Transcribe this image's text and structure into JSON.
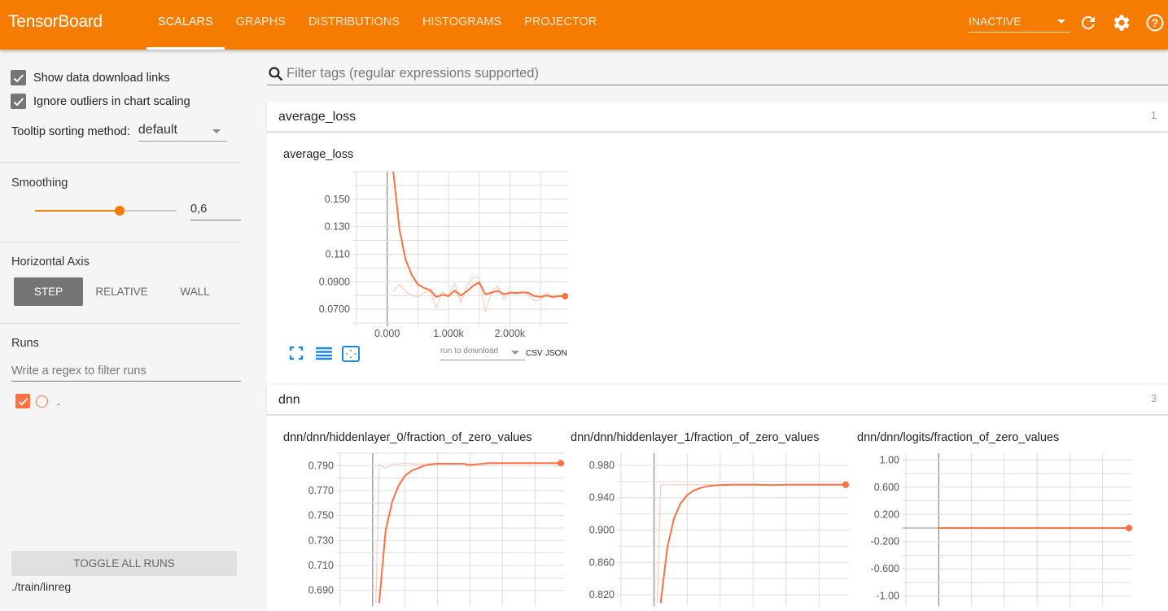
{
  "header": {
    "brand": "TensorBoard",
    "tabs": [
      {
        "label": "SCALARS",
        "active": true
      },
      {
        "label": "GRAPHS",
        "active": false
      },
      {
        "label": "DISTRIBUTIONS",
        "active": false
      },
      {
        "label": "HISTOGRAMS",
        "active": false
      },
      {
        "label": "PROJECTOR",
        "active": false
      }
    ],
    "status_select": "INACTIVE",
    "icons": [
      "refresh-icon",
      "settings-icon",
      "help-icon"
    ],
    "accent_color": "#f57c00"
  },
  "sidebar": {
    "show_download_links": {
      "label": "Show data download links",
      "checked": true
    },
    "ignore_outliers": {
      "label": "Ignore outliers in chart scaling",
      "checked": true
    },
    "tooltip_sorting": {
      "label": "Tooltip sorting method:",
      "value": "default"
    },
    "smoothing": {
      "label": "Smoothing",
      "value": "0,6",
      "fraction": 0.6
    },
    "horizontal_axis": {
      "label": "Horizontal Axis",
      "options": [
        "STEP",
        "RELATIVE",
        "WALL"
      ],
      "selected": "STEP"
    },
    "runs": {
      "label": "Runs",
      "filter_placeholder": "Write a regex to filter runs",
      "items": [
        {
          "name": ".",
          "checked": true,
          "color": "#ff7043"
        }
      ],
      "toggle_all_label": "TOGGLE ALL RUNS",
      "logdir": "./train/linreg"
    }
  },
  "main": {
    "filter_placeholder": "Filter tags (regular expressions supported)",
    "categories": [
      {
        "name": "average_loss",
        "count": "1",
        "download": {
          "select_placeholder": "run to download",
          "csv": "CSV",
          "json": "JSON"
        }
      },
      {
        "name": "dnn",
        "count": "3"
      }
    ]
  },
  "chart_data": [
    {
      "type": "line",
      "title": "average_loss",
      "xlabel": "",
      "ylabel": "",
      "x_ticks": [
        "0.000",
        "1.000k",
        "2.000k"
      ],
      "y_ticks": [
        "0.150",
        "0.130",
        "0.110",
        "0.0900",
        "0.0700"
      ],
      "xlim": [
        -500,
        2950
      ],
      "ylim": [
        0.06,
        0.17
      ],
      "grid": true,
      "series": [
        {
          "name": "smoothed",
          "color": "#ff7043",
          "x": [
            100,
            200,
            300,
            400,
            500,
            600,
            700,
            800,
            900,
            1000,
            1100,
            1200,
            1300,
            1400,
            1500,
            1600,
            1700,
            1800,
            1900,
            2000,
            2100,
            2200,
            2300,
            2400,
            2500,
            2600,
            2700,
            2800,
            2900
          ],
          "y": [
            0.17,
            0.128,
            0.106,
            0.095,
            0.088,
            0.0855,
            0.084,
            0.079,
            0.0805,
            0.0795,
            0.0835,
            0.08,
            0.083,
            0.087,
            0.0895,
            0.081,
            0.082,
            0.0835,
            0.081,
            0.082,
            0.0818,
            0.0822,
            0.082,
            0.0795,
            0.079,
            0.08,
            0.079,
            0.0795,
            0.0795
          ]
        },
        {
          "name": "raw",
          "color": "#ffccbc",
          "x": [
            100,
            200,
            300,
            400,
            500,
            600,
            700,
            800,
            900,
            1000,
            1100,
            1200,
            1300,
            1400,
            1500,
            1600,
            1700,
            1800,
            1900,
            2000,
            2100,
            2200,
            2300,
            2400,
            2500,
            2600,
            2700,
            2800,
            2900
          ],
          "y": [
            0.083,
            0.088,
            0.083,
            0.08,
            0.079,
            0.082,
            0.083,
            0.071,
            0.083,
            0.079,
            0.089,
            0.075,
            0.087,
            0.093,
            0.093,
            0.068,
            0.083,
            0.087,
            0.077,
            0.083,
            0.081,
            0.083,
            0.081,
            0.076,
            0.077,
            0.082,
            0.078,
            0.08,
            0.079
          ]
        }
      ]
    },
    {
      "type": "line",
      "title": "dnn/dnn/hiddenlayer_0/fraction_of_zero_values",
      "y_ticks": [
        "0.790",
        "0.770",
        "0.750",
        "0.730",
        "0.710",
        "0.690"
      ],
      "xlim": [
        -500,
        2950
      ],
      "ylim": [
        0.68,
        0.8
      ],
      "grid": true,
      "series": [
        {
          "name": "smoothed",
          "color": "#ff7043",
          "x": [
            100,
            200,
            300,
            400,
            500,
            600,
            700,
            800,
            900,
            1000,
            1200,
            1400,
            1500,
            1600,
            1800,
            2000,
            2200,
            2400,
            2600,
            2800,
            2900
          ],
          "y": [
            0.68,
            0.738,
            0.761,
            0.774,
            0.782,
            0.786,
            0.788,
            0.79,
            0.791,
            0.7915,
            0.7915,
            0.7915,
            0.7905,
            0.791,
            0.792,
            0.792,
            0.792,
            0.792,
            0.792,
            0.792,
            0.792
          ]
        },
        {
          "name": "raw",
          "color": "#ffccbc",
          "x": [
            50,
            100,
            200,
            300,
            500,
            700,
            1000,
            1500,
            2000,
            2500,
            2900
          ],
          "y": [
            0.68,
            0.791,
            0.788,
            0.791,
            0.792,
            0.791,
            0.792,
            0.791,
            0.792,
            0.792,
            0.792
          ]
        }
      ]
    },
    {
      "type": "line",
      "title": "dnn/dnn/hiddenlayer_1/fraction_of_zero_values",
      "y_ticks": [
        "0.980",
        "0.940",
        "0.900",
        "0.860",
        "0.820"
      ],
      "xlim": [
        -500,
        2950
      ],
      "ylim": [
        0.81,
        0.995
      ],
      "grid": true,
      "series": [
        {
          "name": "smoothed",
          "color": "#ff7043",
          "x": [
            100,
            200,
            300,
            400,
            500,
            600,
            700,
            800,
            900,
            1000,
            1200,
            1500,
            1800,
            2000,
            2200,
            2500,
            2800,
            2900
          ],
          "y": [
            0.81,
            0.878,
            0.914,
            0.933,
            0.943,
            0.949,
            0.952,
            0.954,
            0.955,
            0.9555,
            0.956,
            0.956,
            0.9555,
            0.956,
            0.956,
            0.956,
            0.956,
            0.956
          ]
        },
        {
          "name": "raw",
          "color": "#ffccbc",
          "x": [
            50,
            100,
            500,
            1000,
            2000,
            2900
          ],
          "y": [
            0.81,
            0.956,
            0.956,
            0.956,
            0.956,
            0.956
          ]
        }
      ]
    },
    {
      "type": "line",
      "title": "dnn/dnn/logits/fraction_of_zero_values",
      "y_ticks": [
        "1.00",
        "0.600",
        "0.200",
        "-0.200",
        "-0.600",
        "-1.00"
      ],
      "xlim": [
        -500,
        2950
      ],
      "ylim": [
        -1.1,
        1.1
      ],
      "grid": true,
      "series": [
        {
          "name": "smoothed",
          "color": "#ff7043",
          "x": [
            0,
            2900
          ],
          "y": [
            0,
            0
          ]
        }
      ]
    }
  ]
}
